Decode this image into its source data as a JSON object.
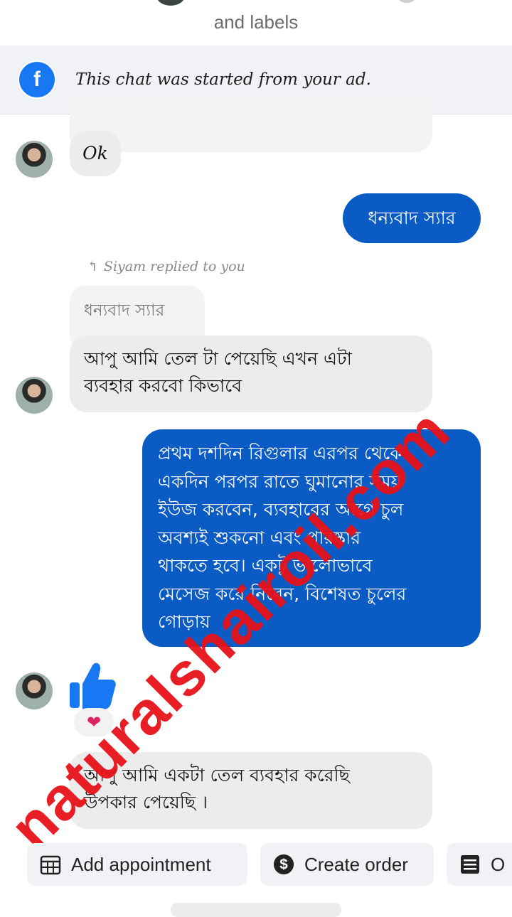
{
  "header": {
    "subtitle": "and labels"
  },
  "ad_banner": {
    "icon": "facebook-icon",
    "text": "This chat was started from your ad."
  },
  "messages": {
    "m1": {
      "text": "Ok"
    },
    "m2": {
      "text": "ধন্যবাদ স্যার"
    },
    "reply": {
      "label": "Siyam replied to you",
      "quoted": "ধন্যবাদ স্যার"
    },
    "m3": {
      "line1": "আপু আমি তেল টা পেয়েছি এখন এটা",
      "line2": "ব্যবহার করবো কিভাবে"
    },
    "m4": {
      "line1": "প্রথম দশদিন রিগুলার এরপর থেকে",
      "line2": "একদিন পরপর রাতে ঘুমানোর সময়",
      "line3": "ইউজ করবেন, ব্যবহারের আগে চুল",
      "line4": "অবশ্যই শুকনো এবং পরিষ্কার",
      "line5": "থাকতে হবে। একটু ভালোভাবে",
      "line6": "মেসেজ করে নিবেন, বিশেষত চুলের",
      "line7": "গোড়ায়"
    },
    "m5": {
      "reaction": "❤"
    },
    "m6": {
      "line1": "আপু আমি একটা তেল ব্যবহার করেছি",
      "line2": "উপকার পেয়েছি ।"
    }
  },
  "watermark": "naturalshairoil.com",
  "actions": {
    "add_appointment": "Add appointment",
    "create_order": "Create order",
    "third": "O"
  },
  "colors": {
    "outgoing": "#0a5bc4",
    "incoming": "#ececec",
    "watermark": "#e8121a",
    "fb": "#1877f2"
  }
}
